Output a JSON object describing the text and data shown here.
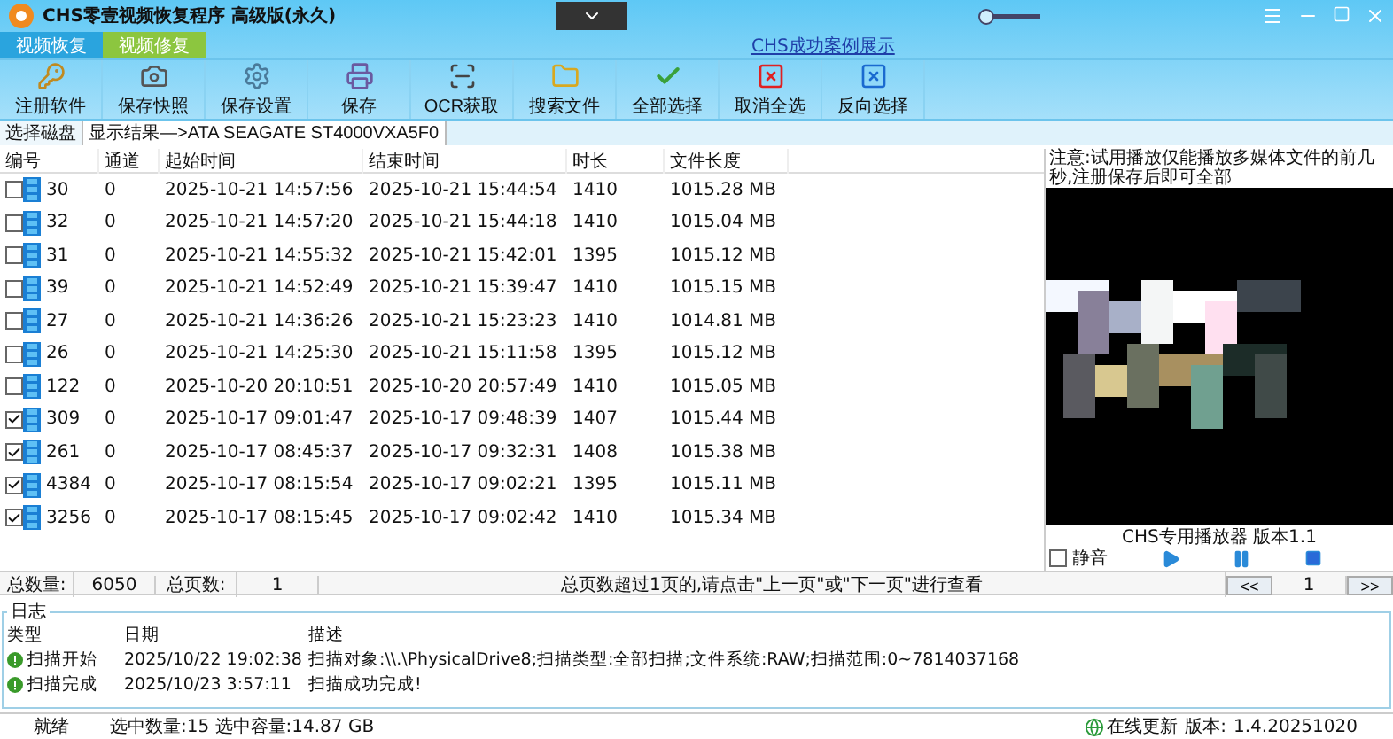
{
  "window": {
    "title": "CHS零壹视频恢复程序 高级版(永久)",
    "volume": {
      "level": 0.08
    }
  },
  "tabs": [
    {
      "label": "视频恢复",
      "selected": false
    },
    {
      "label": "视频修复",
      "selected": true
    }
  ],
  "case_link": "CHS成功案例展示",
  "toolbar": [
    {
      "label": "注册软件"
    },
    {
      "label": "保存快照"
    },
    {
      "label": "保存设置"
    },
    {
      "label": "保存"
    },
    {
      "label": "OCR获取"
    },
    {
      "label": "搜索文件"
    },
    {
      "label": "全部选择"
    },
    {
      "label": "取消全选"
    },
    {
      "label": "反向选择"
    }
  ],
  "disk_tabs": [
    {
      "label": "选择磁盘",
      "selected": false
    },
    {
      "label": "显示结果—>ATA    SEAGATE ST4000VXA5F0",
      "selected": true
    }
  ],
  "table": {
    "columns": [
      "编号",
      "通道",
      "起始时间",
      "结束时间",
      "时长",
      "文件长度"
    ],
    "rows": [
      {
        "checked": false,
        "cells": [
          "30",
          "0",
          "2025-10-21 14:57:56",
          "2025-10-21 15:44:54",
          "1410",
          "1015.28 MB"
        ]
      },
      {
        "checked": false,
        "cells": [
          "32",
          "0",
          "2025-10-21 14:57:20",
          "2025-10-21 15:44:18",
          "1410",
          "1015.04 MB"
        ]
      },
      {
        "checked": false,
        "cells": [
          "31",
          "0",
          "2025-10-21 14:55:32",
          "2025-10-21 15:42:01",
          "1395",
          "1015.12 MB"
        ]
      },
      {
        "checked": false,
        "cells": [
          "39",
          "0",
          "2025-10-21 14:52:49",
          "2025-10-21 15:39:47",
          "1410",
          "1015.15 MB"
        ]
      },
      {
        "checked": false,
        "cells": [
          "27",
          "0",
          "2025-10-21 14:36:26",
          "2025-10-21 15:23:23",
          "1410",
          "1014.81 MB"
        ]
      },
      {
        "checked": false,
        "cells": [
          "26",
          "0",
          "2025-10-21 14:25:30",
          "2025-10-21 15:11:58",
          "1395",
          "1015.12 MB"
        ]
      },
      {
        "checked": false,
        "cells": [
          "122",
          "0",
          "2025-10-20 20:10:51",
          "2025-10-20 20:57:49",
          "1410",
          "1015.05 MB"
        ]
      },
      {
        "checked": true,
        "cells": [
          "309",
          "0",
          "2025-10-17 09:01:47",
          "2025-10-17 09:48:39",
          "1407",
          "1015.44 MB"
        ]
      },
      {
        "checked": true,
        "cells": [
          "261",
          "0",
          "2025-10-17 08:45:37",
          "2025-10-17 09:32:31",
          "1408",
          "1015.38 MB"
        ]
      },
      {
        "checked": true,
        "cells": [
          "4384",
          "0",
          "2025-10-17 08:15:54",
          "2025-10-17 09:02:21",
          "1395",
          "1015.11 MB"
        ]
      },
      {
        "checked": true,
        "cells": [
          "3256",
          "0",
          "2025-10-17 08:15:45",
          "2025-10-17 09:02:42",
          "1410",
          "1015.34 MB"
        ]
      }
    ]
  },
  "summary": {
    "total_label": "总数量:",
    "total": "6050",
    "pages_label": "总页数:",
    "pages": "1",
    "hint": "总页数超过1页的,请点击\"上一页\"或\"下一页\"进行查看",
    "prev": "<<",
    "page": "1",
    "next": ">>"
  },
  "player": {
    "note": "注意:试用播放仅能播放多媒体文件的前几秒,注册保存后即可全部",
    "caption": "CHS专用播放器 版本1.1",
    "mute": {
      "label": "静音",
      "checked": false
    }
  },
  "log": {
    "title": "日志",
    "columns": [
      "类型",
      "日期",
      "描述"
    ],
    "rows": [
      {
        "type": "扫描开始",
        "date": "2025/10/22 19:02:38",
        "desc": "扫描对象:\\\\.\\PhysicalDrive8;扫描类型:全部扫描;文件系统:RAW;扫描范围:0~7814037168"
      },
      {
        "type": "扫描完成",
        "date": "2025/10/23 3:57:11",
        "desc": "扫描成功完成!"
      }
    ]
  },
  "status_bar": {
    "state": "就绪",
    "selection": "选中数量:15 选中容量:14.87 GB",
    "update": "在线更新",
    "version_label": "版本:",
    "version": "1.4.20251020"
  }
}
